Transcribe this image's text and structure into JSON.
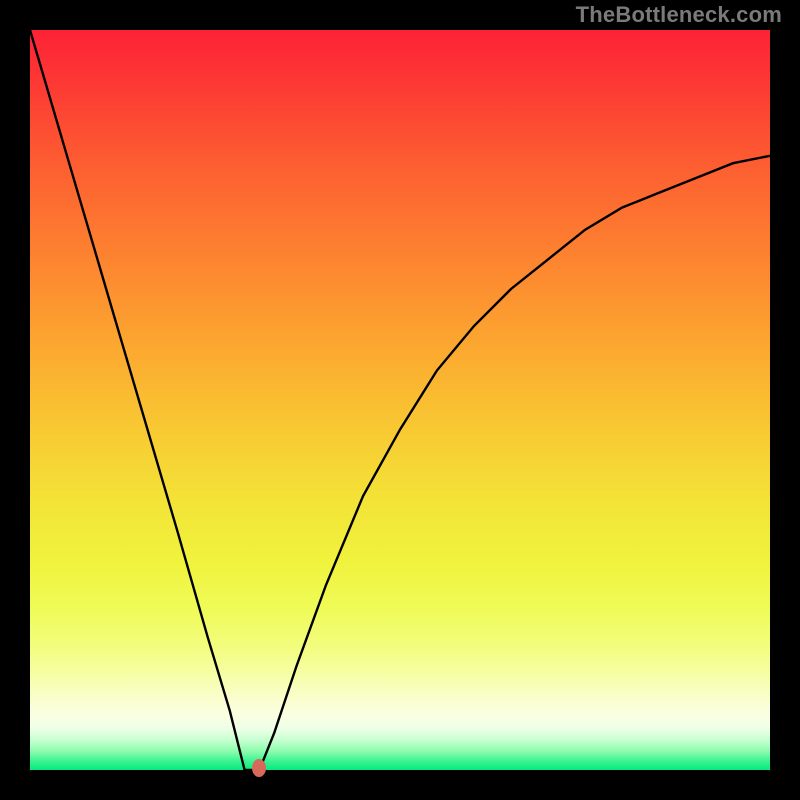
{
  "watermark": {
    "text": "TheBottleneck.com"
  },
  "plot": {
    "dot_color": "#d66a5a",
    "curve_color": "#000000",
    "curve_width": 2.4
  },
  "chart_data": {
    "type": "line",
    "title": "",
    "xlabel": "",
    "ylabel": "",
    "xlim": [
      0,
      100
    ],
    "ylim": [
      0,
      100
    ],
    "notch_x": 31,
    "notch_plateau_x": [
      29,
      31
    ],
    "series": [
      {
        "name": "bottleneck-curve",
        "x": [
          0,
          5,
          10,
          15,
          20,
          24,
          27,
          29,
          31,
          33,
          36,
          40,
          45,
          50,
          55,
          60,
          65,
          70,
          75,
          80,
          85,
          90,
          95,
          100
        ],
        "values": [
          100,
          83,
          66,
          49,
          32,
          18,
          8,
          0,
          0,
          5,
          14,
          25,
          37,
          46,
          54,
          60,
          65,
          69,
          73,
          76,
          78,
          80,
          82,
          83
        ]
      }
    ],
    "annotations": [
      {
        "type": "dot",
        "x": 31,
        "y": 0,
        "color": "#d66a5a"
      }
    ]
  }
}
